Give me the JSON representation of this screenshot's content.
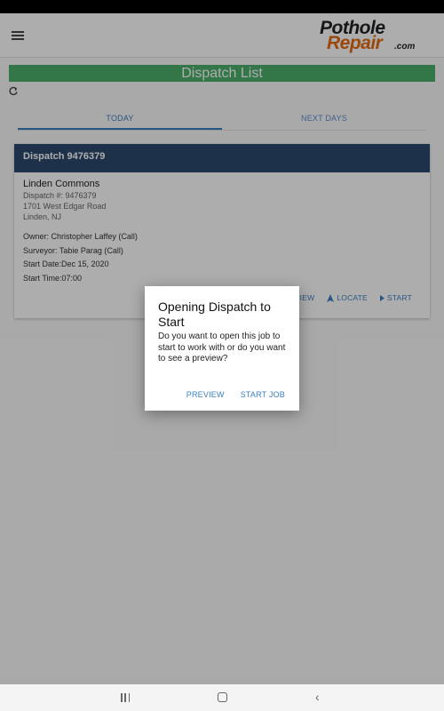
{
  "logo": {
    "line1": "Pothole",
    "line2": "Repair",
    "line3": ".com"
  },
  "page": {
    "title": "Dispatch List"
  },
  "tabs": [
    {
      "label": "TODAY"
    },
    {
      "label": "NEXT DAYS"
    }
  ],
  "dispatch": {
    "header": "Dispatch 9476379",
    "location_name": "Linden Commons",
    "number": "Dispatch #: 9476379",
    "address": "1701 West Edgar Road",
    "city": "Linden, NJ",
    "owner": "Owner: Christopher Laffey (Call)",
    "surveyor": "Surveyor: Tabie Parag (Call)",
    "start_date": "Start Date:Dec 15, 2020",
    "start_time": "Start Time:07:00",
    "actions": {
      "preview": "VIEW",
      "locate": "LOCATE",
      "start": "START"
    }
  },
  "dialog": {
    "title": "Opening Dispatch to Start",
    "message": "Do you want to open this job to start to work with or do you want to see a preview?",
    "preview_label": "PREVIEW",
    "start_label": "START JOB"
  },
  "colors": {
    "accent": "#3c7fc1",
    "title_bar": "#4caf6a",
    "card_header": "#2c4a6e",
    "logo_orange": "#e46a12"
  },
  "icons": {
    "menu": "hamburger-icon",
    "refresh": "refresh-icon",
    "locate": "navigation-arrow-icon",
    "start": "play-icon",
    "recent": "recent-apps-icon",
    "home": "home-icon",
    "back": "back-icon"
  }
}
